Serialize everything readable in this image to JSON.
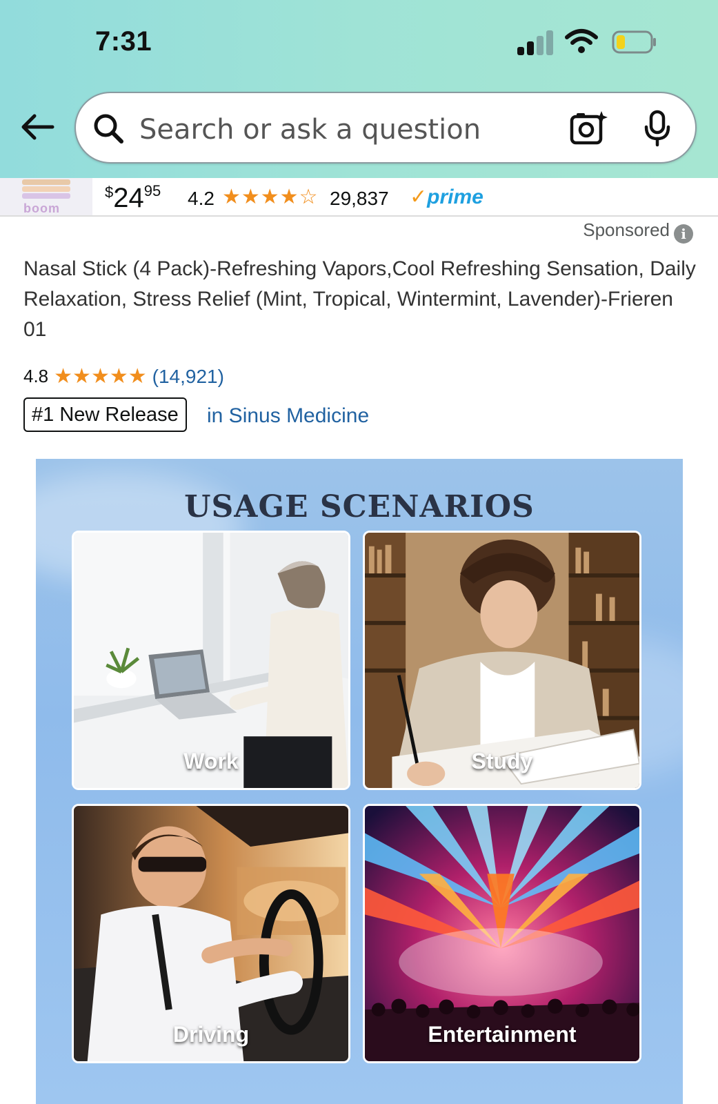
{
  "status_bar": {
    "time": "7:31"
  },
  "search": {
    "placeholder": "Search or ask a question"
  },
  "previous_result": {
    "price_symbol": "$",
    "price_whole": "24",
    "price_cents": "95",
    "rating": "4.2",
    "stars": "★★★★☆",
    "review_count": "29,837",
    "prime_check": "✓",
    "prime_label": "prime",
    "thumb_brand": "boom"
  },
  "product": {
    "sponsored_label": "Sponsored",
    "info_glyph": "i",
    "title": "Nasal Stick (4 Pack)-Refreshing Vapors,Cool Refreshing Sensation, Daily Relaxation, Stress Relief (Mint, Tropical, Wintermint, Lavender)-Frieren 01",
    "rating": "4.8",
    "stars": "★★★★★",
    "review_count": "(14,921)",
    "badge": "#1 New Release",
    "badge_category": "in Sinus Medicine"
  },
  "product_image": {
    "heading": "USAGE SCENARIOS",
    "tiles": [
      {
        "label": "Work"
      },
      {
        "label": "Study"
      },
      {
        "label": "Driving"
      },
      {
        "label": "Entertainment"
      }
    ]
  },
  "colors": {
    "header_gradient": [
      "#92dcdc",
      "#a6e6d2"
    ],
    "star": "#f18e1d",
    "link": "#2162a1",
    "prime": "#1ea0e0",
    "image_bg": "#9cc3ea"
  },
  "icons": [
    "back-arrow-icon",
    "search-icon",
    "camera-sparkle-icon",
    "microphone-icon",
    "signal-icon",
    "wifi-icon",
    "battery-icon",
    "info-icon"
  ]
}
